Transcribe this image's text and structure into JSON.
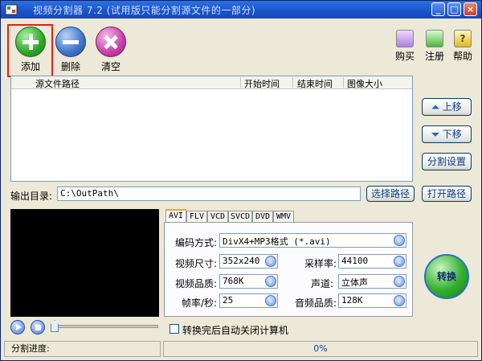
{
  "window": {
    "title": "视频分割器 7.2 (试用版只能分割源文件的一部分)",
    "controls": [
      "_",
      "□",
      "×"
    ]
  },
  "toolbar": {
    "add_label": "添加",
    "delete_label": "删除",
    "clear_label": "清空",
    "buy_label": "购买",
    "register_label": "注册",
    "help_label": "帮助"
  },
  "file_list": {
    "columns": [
      "源文件路径",
      "开始时间",
      "结束时间",
      "图像大小"
    ],
    "rows": []
  },
  "side_buttons": {
    "move_up": "上移",
    "move_down": "下移",
    "split_settings": "分割设置",
    "open_path": "打开路径"
  },
  "output": {
    "label": "输出目录:",
    "value": "C:\\OutPath\\",
    "choose_button": "选择路径"
  },
  "tabs": [
    "AVI",
    "FLV",
    "VCD",
    "SVCD",
    "DVD",
    "WMV"
  ],
  "active_tab": "AVI",
  "settings": {
    "codec_label": "编码方式:",
    "codec_value": "DivX4+MP3格式 (*.avi)",
    "size_label": "视频尺寸:",
    "size_value": "352x240",
    "samplerate_label": "采样率:",
    "samplerate_value": "44100",
    "quality_label": "视频品质:",
    "quality_value": "768K",
    "channel_label": "声道:",
    "channel_value": "立体声",
    "fps_label": "帧率/秒:",
    "fps_value": "25",
    "audio_quality_label": "音频品质:",
    "audio_quality_value": "128K"
  },
  "convert_button": "转换",
  "shutdown_checkbox": {
    "label": "转换完后自动关闭计算机",
    "checked": false
  },
  "status": {
    "label": "分割进度:",
    "progress_text": "0%",
    "progress": 0
  },
  "colors": {
    "titlebar": "#1a53c9",
    "window_bg": "#ece9d8",
    "highlight_box": "#e02020"
  }
}
